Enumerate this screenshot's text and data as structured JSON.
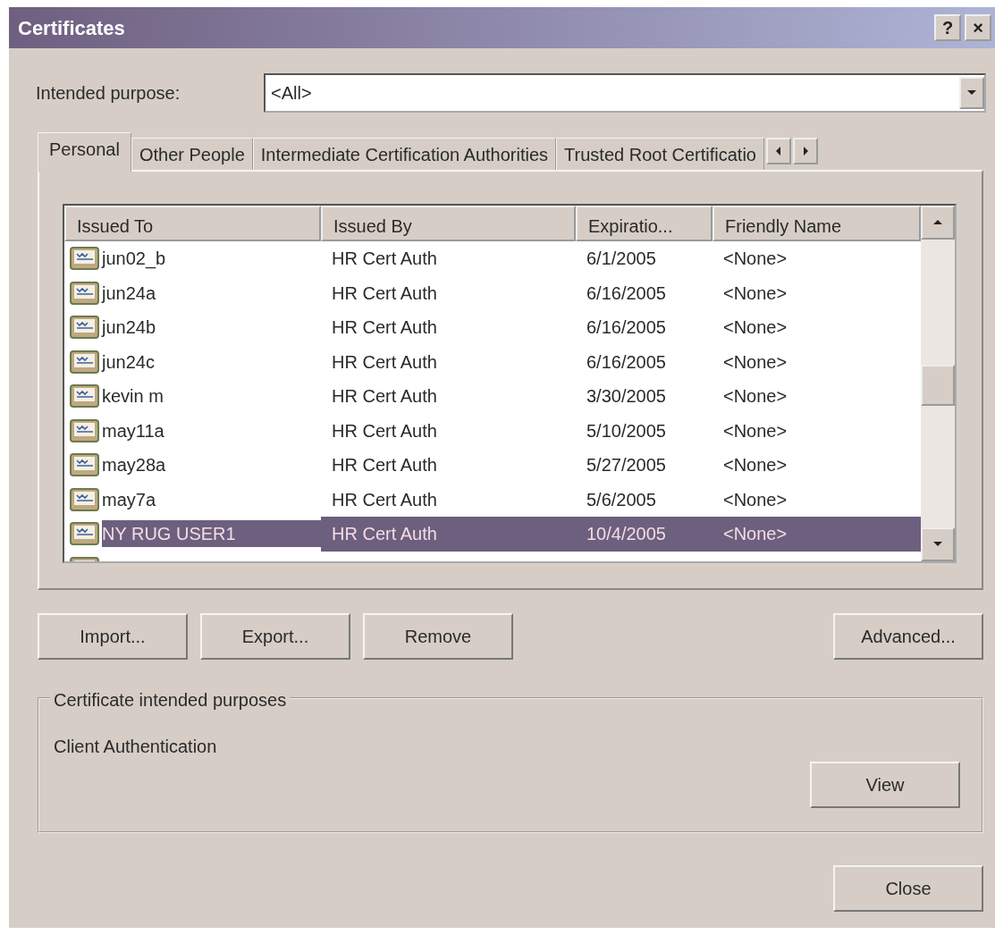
{
  "window": {
    "title": "Certificates",
    "title_buttons": [
      "?",
      "×"
    ]
  },
  "purpose": {
    "label": "Intended purpose:",
    "value": "<All>"
  },
  "tabs": [
    {
      "label": "Personal",
      "selected": true
    },
    {
      "label": "Other People",
      "selected": false
    },
    {
      "label": "Intermediate Certification Authorities",
      "selected": false
    },
    {
      "label": "Trusted Root Certificatio",
      "selected": false
    }
  ],
  "table": {
    "columns": [
      "Issued To",
      "Issued By",
      "Expiratio...",
      "Friendly Name"
    ],
    "rows": [
      {
        "cells": [
          "jun02_b",
          "HR Cert Auth",
          "6/1/2005",
          "<None>"
        ],
        "selected": false
      },
      {
        "cells": [
          "jun24a",
          "HR Cert Auth",
          "6/16/2005",
          "<None>"
        ],
        "selected": false
      },
      {
        "cells": [
          "jun24b",
          "HR Cert Auth",
          "6/16/2005",
          "<None>"
        ],
        "selected": false
      },
      {
        "cells": [
          "jun24c",
          "HR Cert Auth",
          "6/16/2005",
          "<None>"
        ],
        "selected": false
      },
      {
        "cells": [
          "kevin m",
          "HR Cert Auth",
          "3/30/2005",
          "<None>"
        ],
        "selected": false
      },
      {
        "cells": [
          "may11a",
          "HR Cert Auth",
          "5/10/2005",
          "<None>"
        ],
        "selected": false
      },
      {
        "cells": [
          "may28a",
          "HR Cert Auth",
          "5/27/2005",
          "<None>"
        ],
        "selected": false
      },
      {
        "cells": [
          "may7a",
          "HR Cert Auth",
          "5/6/2005",
          "<None>"
        ],
        "selected": false
      },
      {
        "cells": [
          "NY RUG USER1",
          "HR Cert Auth",
          "10/4/2005",
          "<None>"
        ],
        "selected": true
      }
    ]
  },
  "buttons": [
    "Import...",
    "Export...",
    "Remove"
  ],
  "advanced_button": "Advanced...",
  "purposes_group": {
    "title": "Certificate intended purposes",
    "text": "Client Authentication",
    "button": "View"
  },
  "close_button": "Close"
}
